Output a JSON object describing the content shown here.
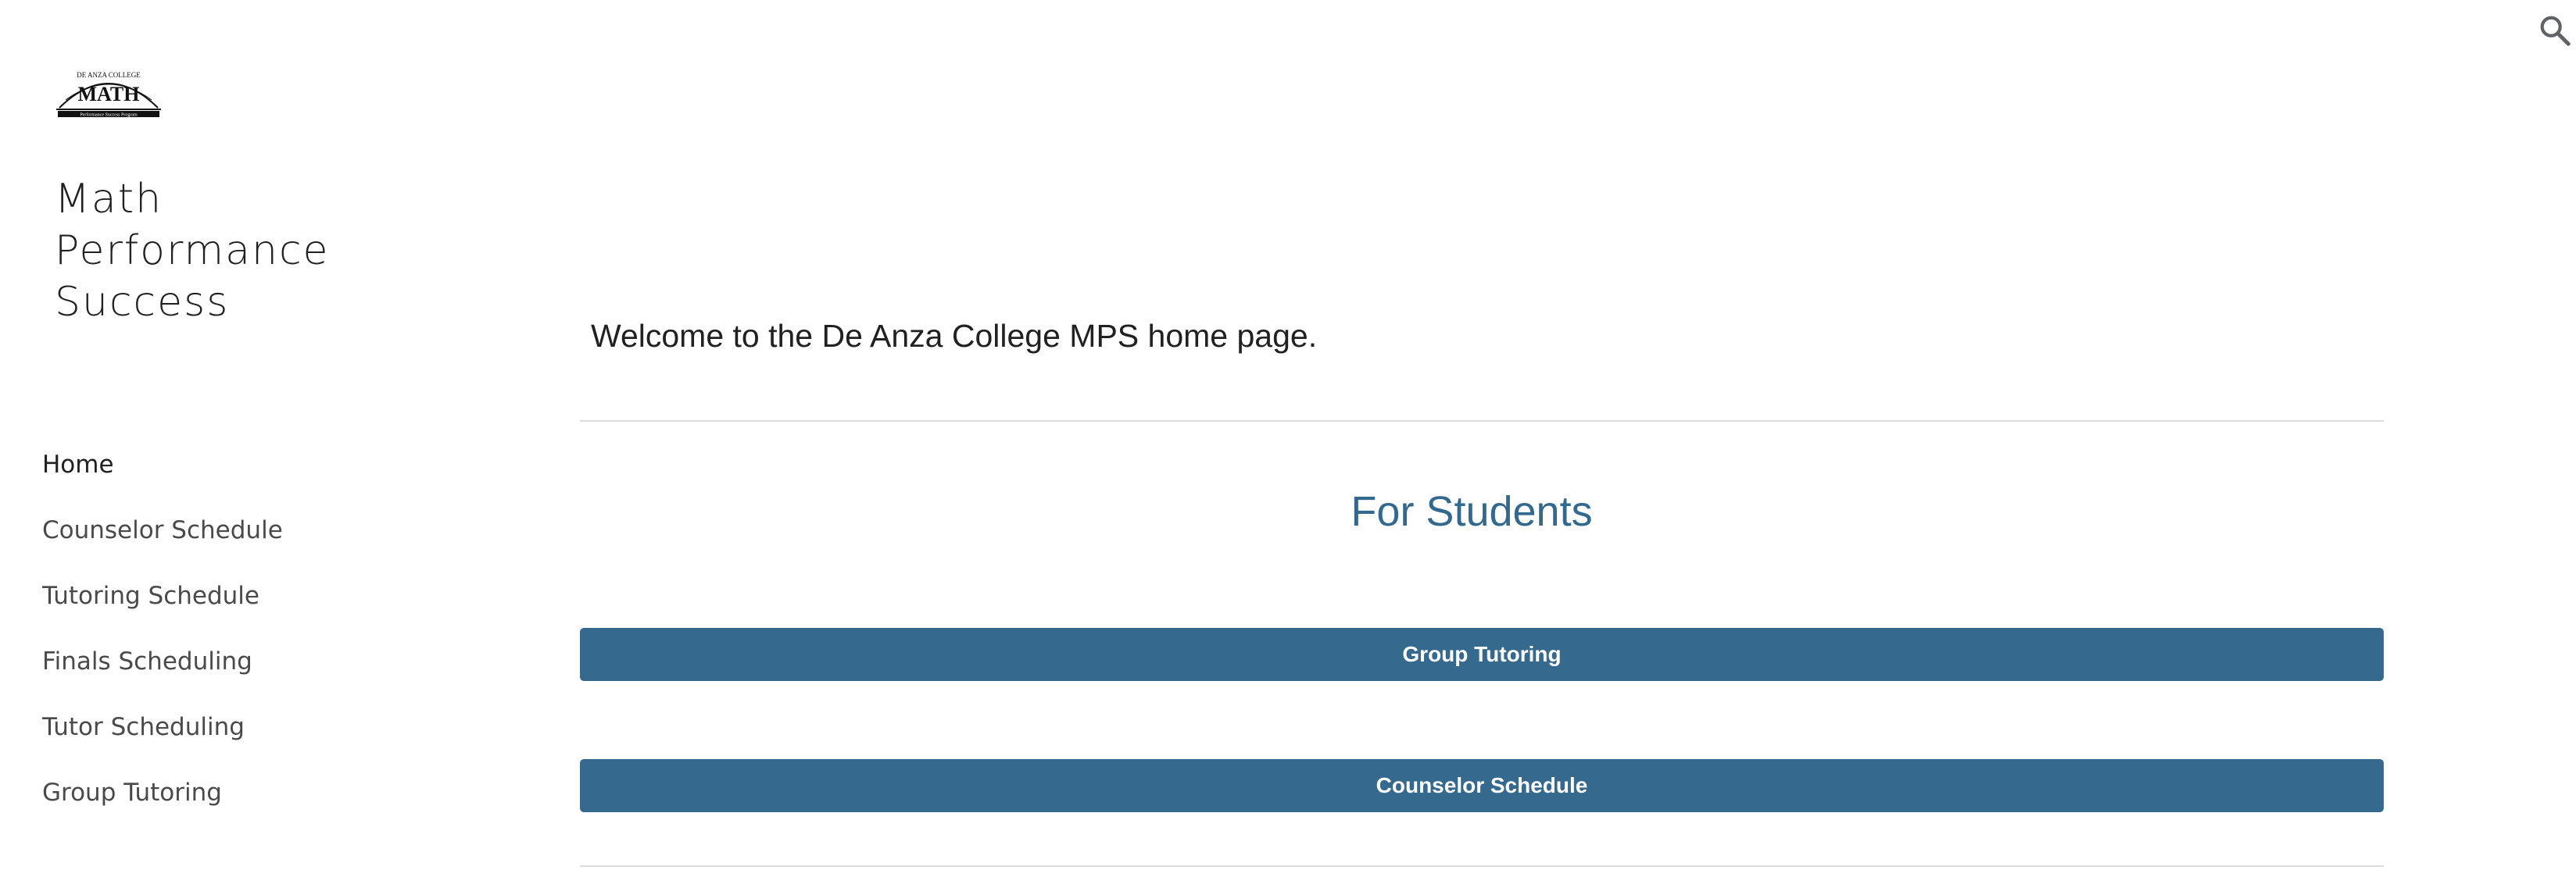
{
  "header": {
    "logo_text": "DE ANZA COLLEGE MATH Performance Success Program",
    "search_icon": "search-icon"
  },
  "sidebar": {
    "site_title": "Math Performance Success",
    "nav_items": [
      {
        "label": "Home",
        "active": true
      },
      {
        "label": "Counselor Schedule",
        "active": false
      },
      {
        "label": "Tutoring Schedule",
        "active": false
      },
      {
        "label": "Finals Scheduling",
        "active": false
      },
      {
        "label": "Tutor Scheduling",
        "active": false
      },
      {
        "label": "Group Tutoring",
        "active": false
      }
    ]
  },
  "main": {
    "welcome_text": "Welcome to the De Anza College MPS home page.",
    "students_heading": "For Students",
    "buttons": [
      {
        "label": "Group Tutoring"
      },
      {
        "label": "Counselor Schedule"
      }
    ]
  },
  "colors": {
    "accent": "#356a8e",
    "heading": "#33698f",
    "text": "#212121",
    "nav_text": "#4a4a4a",
    "divider": "#dcdcdc"
  }
}
